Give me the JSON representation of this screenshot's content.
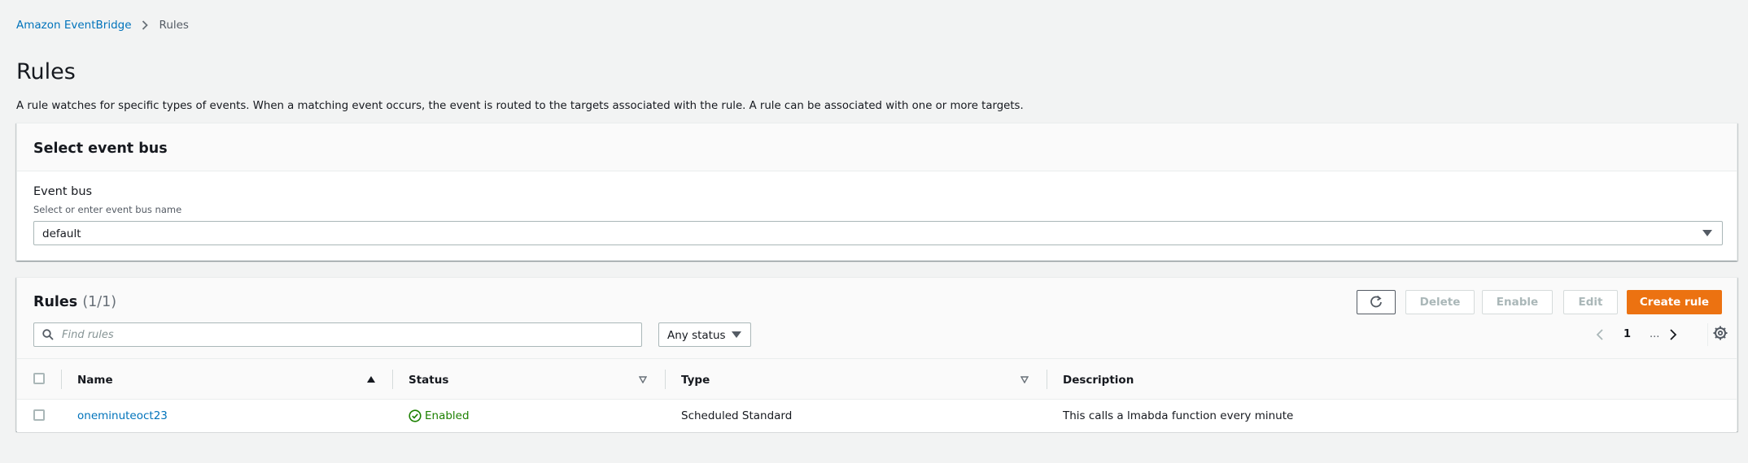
{
  "breadcrumb": {
    "root": "Amazon EventBridge",
    "current": "Rules"
  },
  "page": {
    "title": "Rules",
    "description": "A rule watches for specific types of events. When a matching event occurs, the event is routed to the targets associated with the rule. A rule can be associated with one or more targets."
  },
  "event_bus_panel": {
    "title": "Select event bus",
    "field_label": "Event bus",
    "field_description": "Select or enter event bus name",
    "selected_value": "default"
  },
  "rules_panel": {
    "title": "Rules",
    "count": "(1/1)",
    "buttons": {
      "delete": "Delete",
      "enable": "Enable",
      "edit": "Edit",
      "create": "Create rule"
    },
    "search_placeholder": "Find rules",
    "status_filter": "Any status",
    "pagination": {
      "current_page": "1",
      "ellipsis": "..."
    },
    "columns": {
      "name": "Name",
      "status": "Status",
      "type": "Type",
      "description": "Description"
    },
    "rows": [
      {
        "name": "oneminuteoct23",
        "status": "Enabled",
        "type": "Scheduled Standard",
        "description": "This calls a lmabda function every minute"
      }
    ]
  },
  "colors": {
    "link": "#0073bb",
    "primary_button": "#ec7211",
    "success": "#1d8102",
    "background": "#f2f3f3"
  }
}
